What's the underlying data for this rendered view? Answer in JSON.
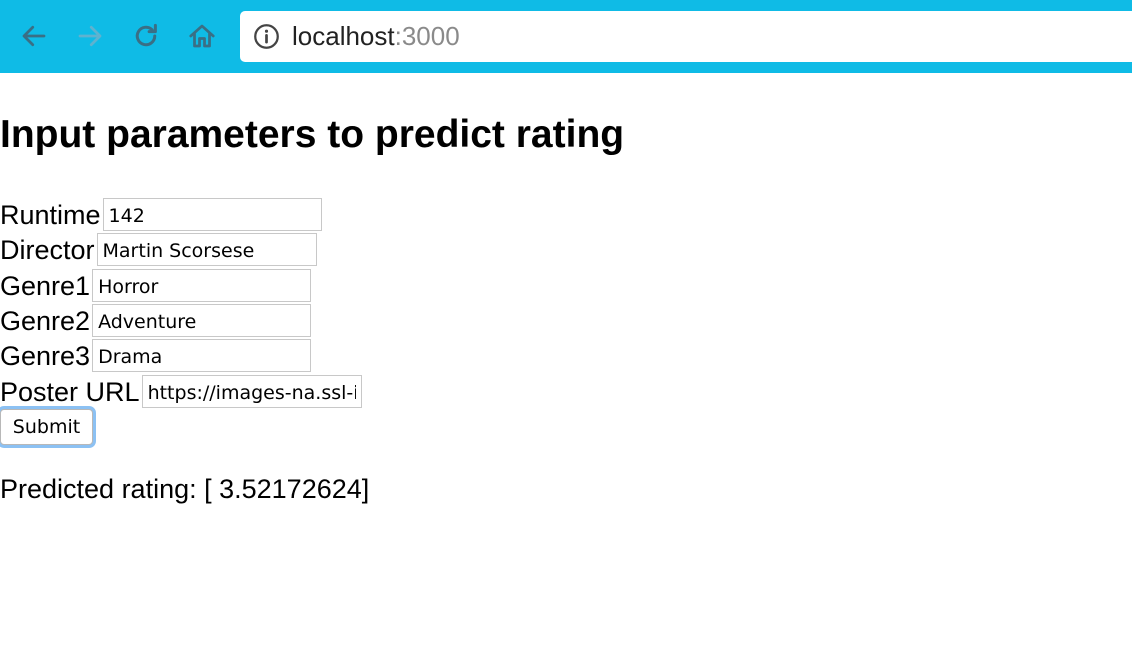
{
  "browser": {
    "url_host": "localhost",
    "url_port": ":3000",
    "icons": [
      "back-arrow-icon",
      "forward-arrow-icon",
      "reload-icon",
      "home-icon",
      "info-icon"
    ]
  },
  "page": {
    "title": "Input parameters to predict rating",
    "fields": [
      {
        "label": "Runtime",
        "value": "142"
      },
      {
        "label": "Director",
        "value": "Martin Scorsese"
      },
      {
        "label": "Genre1",
        "value": "Horror"
      },
      {
        "label": "Genre2",
        "value": "Adventure"
      },
      {
        "label": "Genre3",
        "value": "Drama"
      },
      {
        "label": "Poster URL",
        "value": "https://images-na.ssl-i"
      }
    ],
    "submit_label": "Submit",
    "result_text": "Predicted rating: [ 3.52172624]"
  }
}
